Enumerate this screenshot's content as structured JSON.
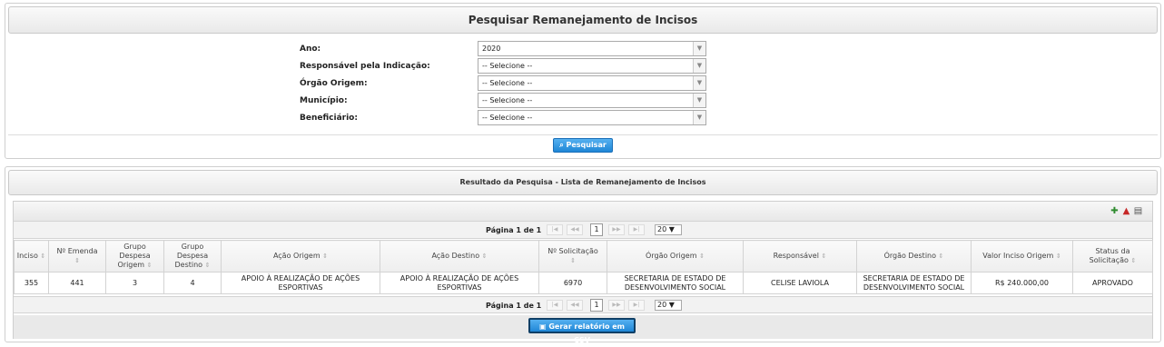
{
  "search_panel": {
    "title": "Pesquisar Remanejamento de Incisos",
    "fields": [
      {
        "label": "Ano:",
        "value": "2020"
      },
      {
        "label": "Responsável pela Indicação:",
        "value": "-- Selecione --"
      },
      {
        "label": "Órgão Origem:",
        "value": "-- Selecione --"
      },
      {
        "label": "Município:",
        "value": "-- Selecione --"
      },
      {
        "label": "Beneficiário:",
        "value": "-- Selecione --"
      }
    ],
    "search_button": "Pesquisar"
  },
  "results_panel": {
    "title": "Resultado da Pesquisa - Lista de Remanejamento de Incisos",
    "export_icons": [
      "excel-icon",
      "pdf-icon",
      "print-icon"
    ],
    "pager": {
      "info": "Página 1 de 1",
      "first": "|◀",
      "prev": "◀◀",
      "page": "1",
      "next": "▶▶",
      "last": "▶|",
      "rows_per_page": "20"
    },
    "columns": [
      "Inciso",
      "Nº Emenda",
      "Grupo Despesa Origem",
      "Grupo Despesa Destino",
      "Ação Origem",
      "Ação Destino",
      "Nº Solicitação",
      "Órgão Origem",
      "Responsável",
      "Órgão Destino",
      "Valor Inciso Origem",
      "Status da Solicitação"
    ],
    "rows": [
      [
        "355",
        "441",
        "3",
        "4",
        "APOIO À REALIZAÇÃO DE AÇÕES ESPORTIVAS",
        "APOIO À REALIZAÇÃO DE AÇÕES ESPORTIVAS",
        "6970",
        "SECRETARIA DE ESTADO DE DESENVOLVIMENTO SOCIAL",
        "CELISE LAVIOLA",
        "SECRETARIA DE ESTADO DE DESENVOLVIMENTO SOCIAL",
        "R$ 240.000,00",
        "APROVADO"
      ]
    ],
    "csv_button": "Gerar relatório em CSV"
  }
}
